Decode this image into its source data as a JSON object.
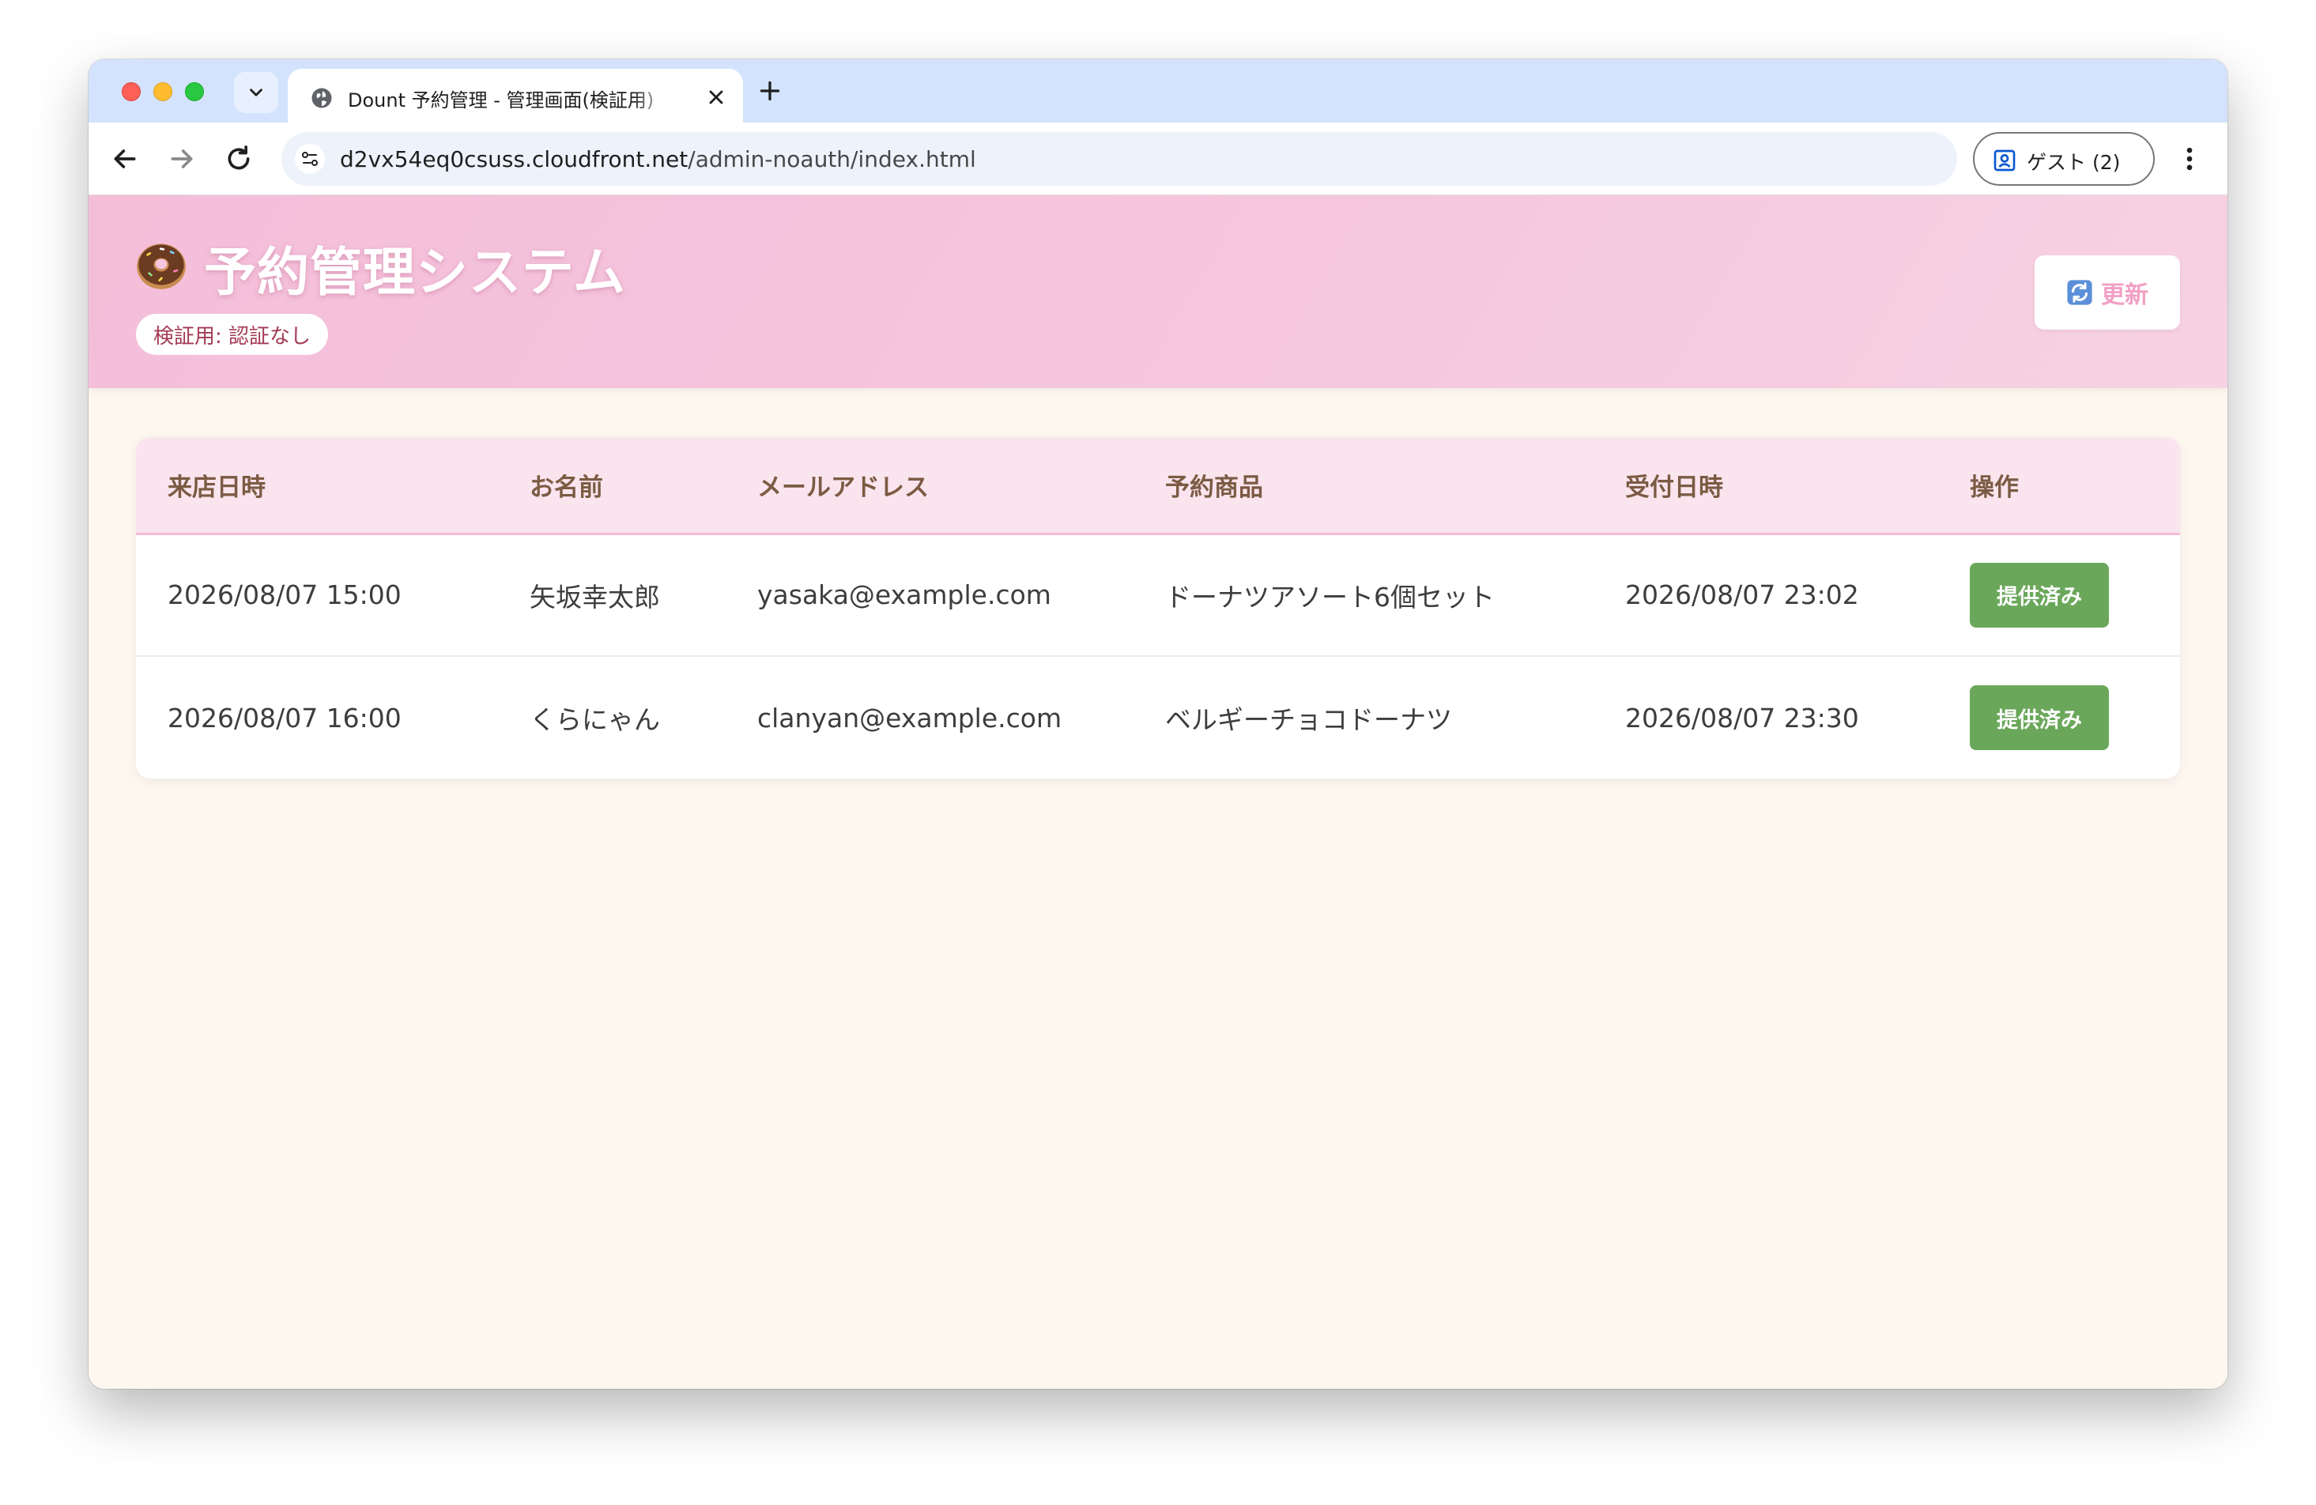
{
  "browser": {
    "tab_title": "Dount 予約管理 - 管理画面(検証用)",
    "url_host": "d2vx54eq0csuss.cloudfront.net",
    "url_path": "/admin-noauth/index.html",
    "profile_label": "ゲスト (2)"
  },
  "header": {
    "title": "予約管理システム",
    "badge": "検証用: 認証なし",
    "refresh_label": "更新",
    "gradient_colors": [
      "#f4bed9",
      "#f7d2e2"
    ]
  },
  "table": {
    "columns": [
      "来店日時",
      "お名前",
      "メールアドレス",
      "予約商品",
      "受付日時",
      "操作"
    ],
    "rows": [
      {
        "visit": "2026/08/07 15:00",
        "name": "矢坂幸太郎",
        "email": "yasaka@example.com",
        "item": "ドーナツアソート6個セット",
        "received": "2026/08/07 23:02",
        "action": "提供済み"
      },
      {
        "visit": "2026/08/07 16:00",
        "name": "くらにゃん",
        "email": "clanyan@example.com",
        "item": "ベルギーチョコドーナツ",
        "received": "2026/08/07 23:30",
        "action": "提供済み"
      }
    ]
  },
  "colors": {
    "accent_pink": "#f4bed9",
    "status_green": "#6aa75a",
    "page_background": "#fdf7f0"
  },
  "icons": [
    "chevron-down-icon",
    "globe-icon",
    "close-icon",
    "plus-icon",
    "back-arrow-icon",
    "forward-arrow-icon",
    "reload-icon",
    "site-info-icon",
    "profile-icon",
    "more-vert-icon",
    "donut-icon",
    "refresh-icon"
  ]
}
